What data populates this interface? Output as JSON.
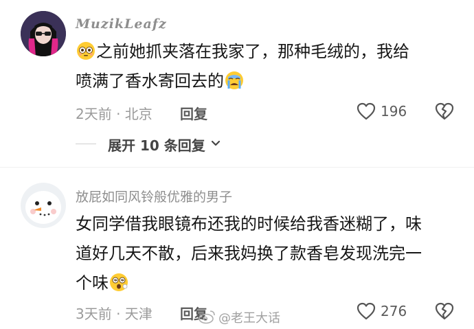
{
  "comments": [
    {
      "username": "MuzikLeafz",
      "text_line1": "之前她抓夹落在我家了，那种毛绒的，我给",
      "text_line2": "喷满了香水寄回去的",
      "meta": "2天前 · 北京",
      "reply_label": "回复",
      "likes": "196",
      "expand_label": "展开 10 条回复"
    },
    {
      "username": "放屁如同风铃般优雅的男子",
      "text_line1": "女同学借我眼镜布还我的时候给我香迷糊了，味",
      "text_line2": "道好几天不散，后来我妈换了款香皂发现洗完一",
      "text_line3": "个味",
      "meta": "3天前 · 天津",
      "reply_label": "回复",
      "likes": "276"
    }
  ],
  "watermark": "@老王大话",
  "colors": {
    "text": "#161616",
    "meta": "#9a9a9a",
    "username": "#8e8e8e"
  }
}
